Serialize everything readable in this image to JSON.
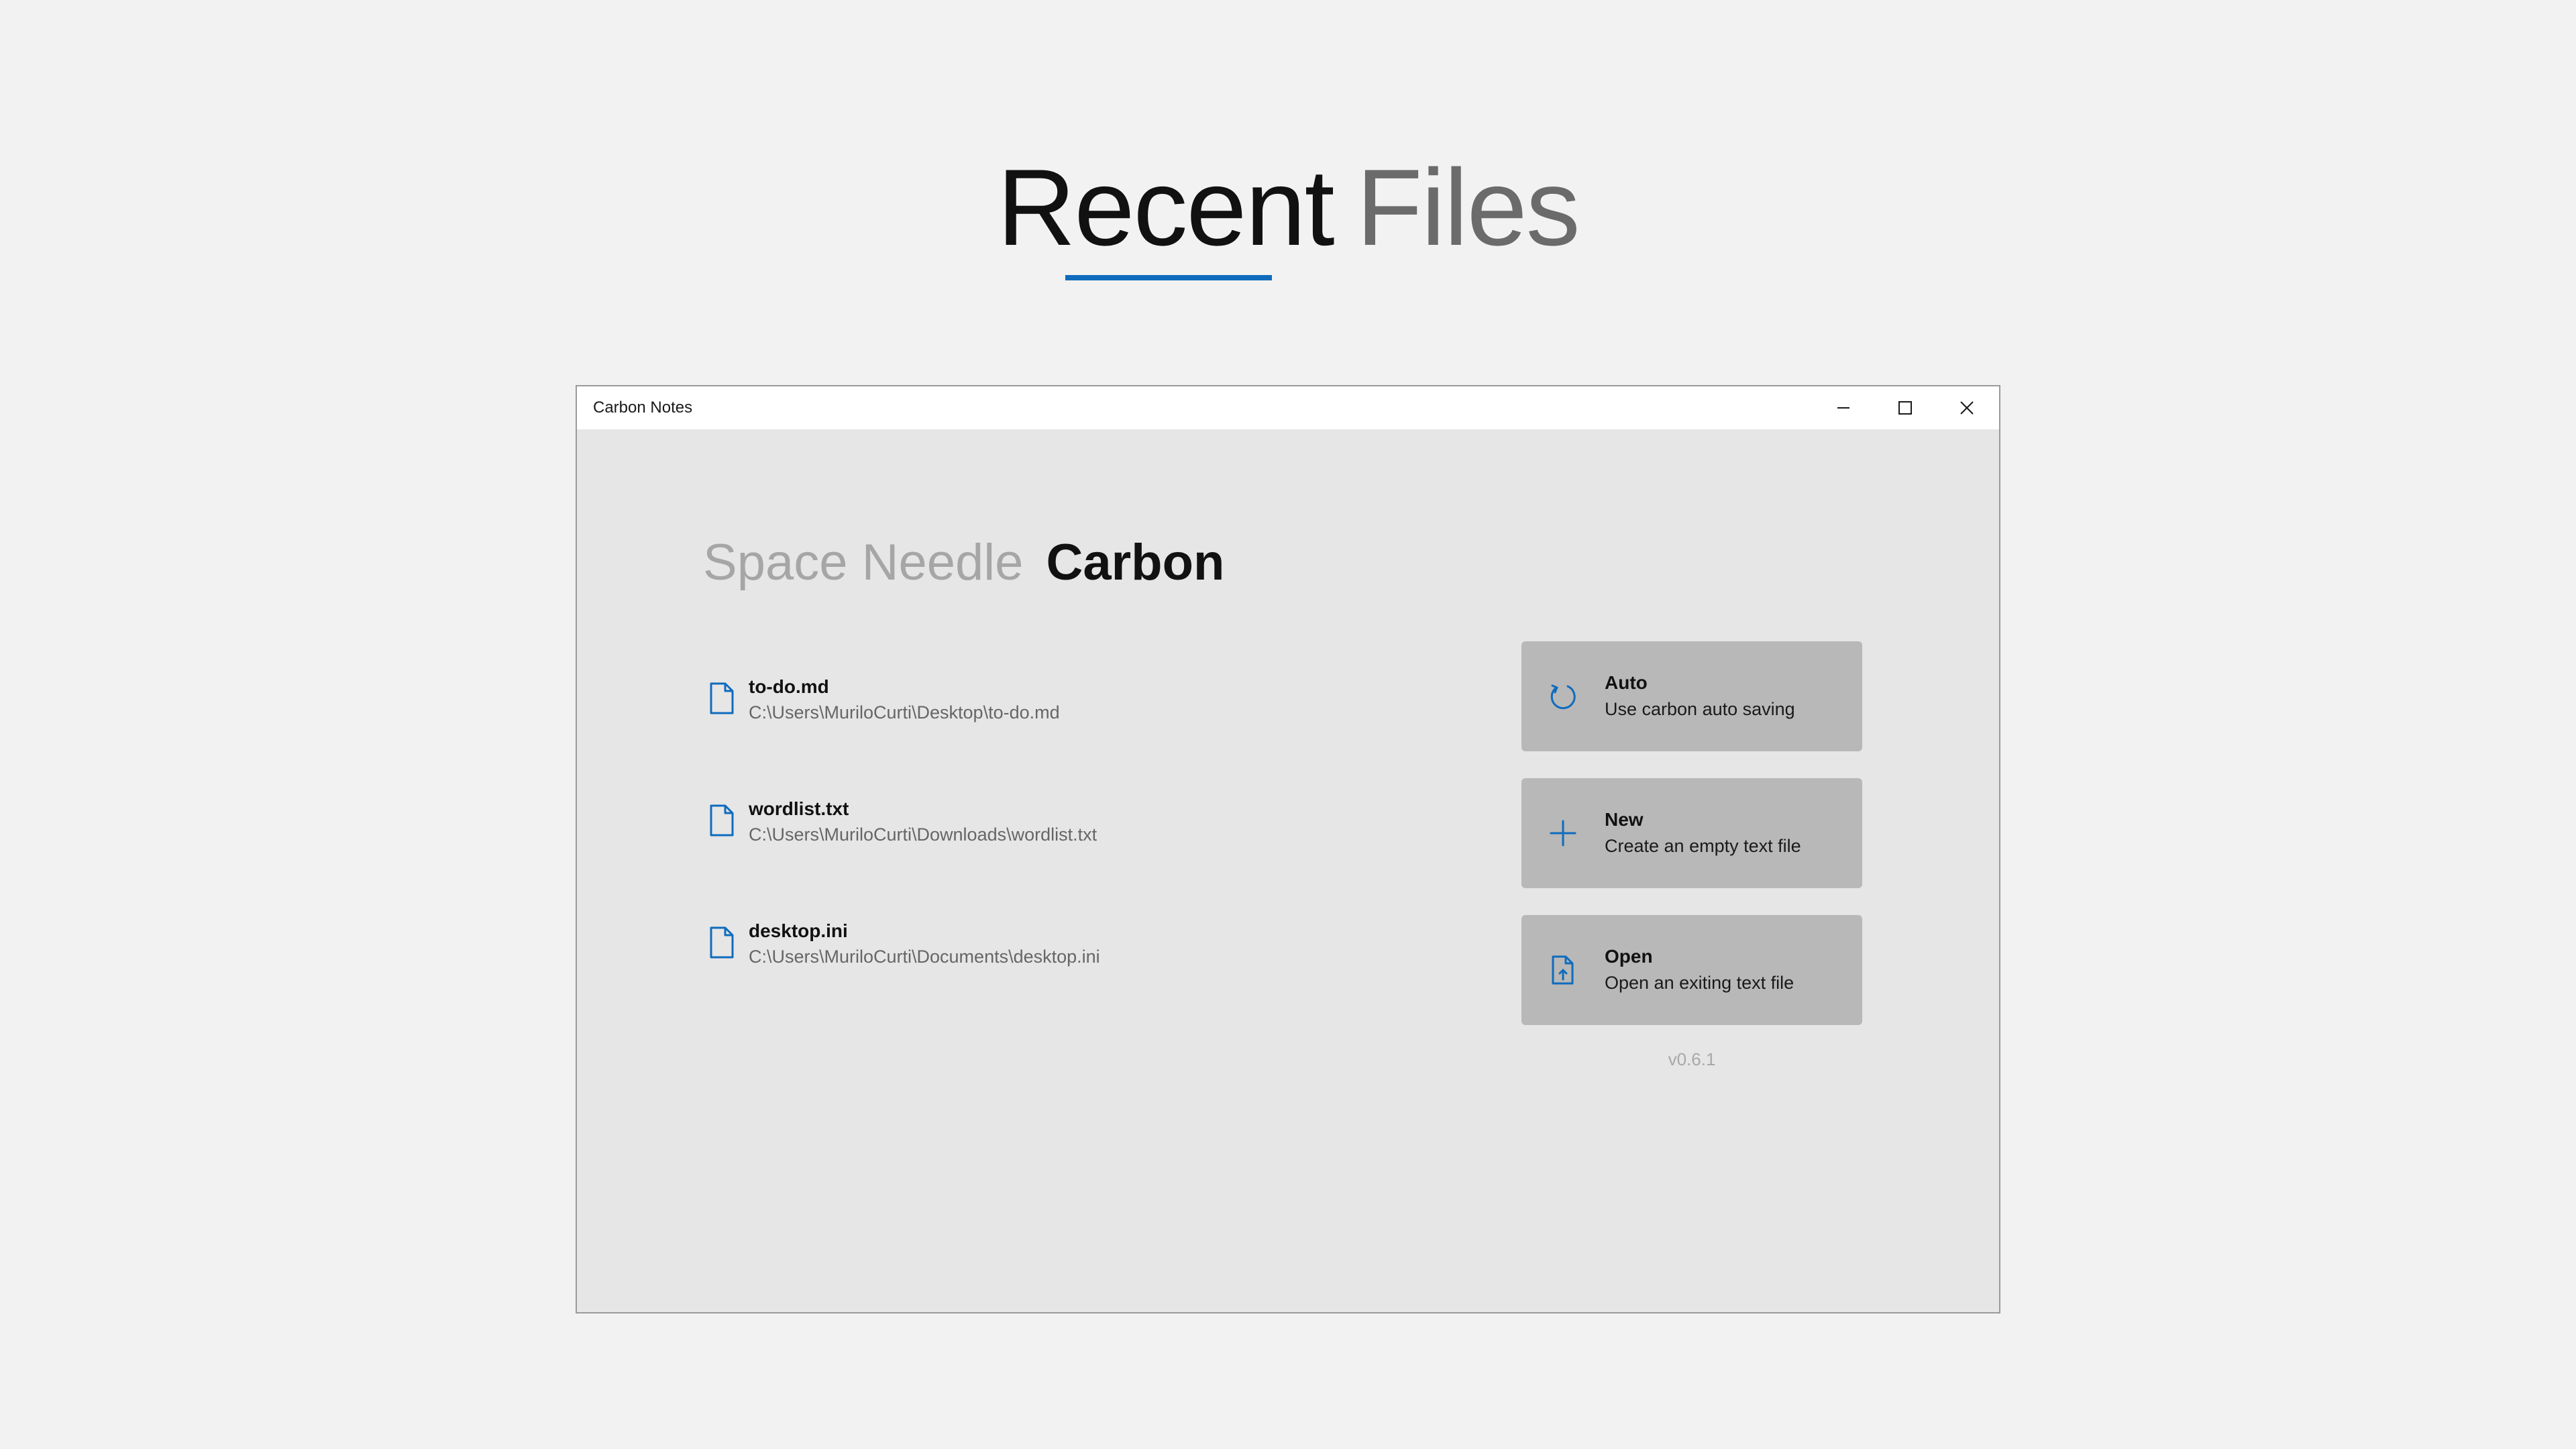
{
  "hero": {
    "word1": "Recent",
    "word2": "Files"
  },
  "window": {
    "title": "Carbon Notes",
    "controls": [
      "minimize-icon",
      "maximize-icon",
      "close-icon"
    ]
  },
  "brand": {
    "light": "Space Needle",
    "bold": "Carbon"
  },
  "recent_files": [
    {
      "name": "to-do.md",
      "path": "C:\\Users\\MuriloCurti\\Desktop\\to-do.md",
      "icon": "document-icon"
    },
    {
      "name": "wordlist.txt",
      "path": "C:\\Users\\MuriloCurti\\Downloads\\wordlist.txt",
      "icon": "document-icon"
    },
    {
      "name": "desktop.ini",
      "path": "C:\\Users\\MuriloCurti\\Documents\\desktop.ini",
      "icon": "document-icon"
    }
  ],
  "actions": [
    {
      "title": "Auto",
      "description": "Use carbon auto saving",
      "icon": "refresh-icon"
    },
    {
      "title": "New",
      "description": "Create an empty text file",
      "icon": "plus-icon"
    },
    {
      "title": "Open",
      "description": "Open an exiting text file",
      "icon": "open-file-icon"
    }
  ],
  "version": "v0.6.1",
  "colors": {
    "accent": "#0f6cbd",
    "page_background": "#f2f2f2",
    "window_background": "#e6e6e6",
    "button_background": "#b8b8b8"
  }
}
